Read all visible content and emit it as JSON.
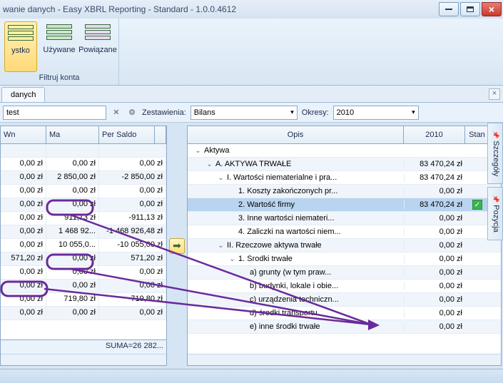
{
  "window": {
    "title": "wanie danych - Easy XBRL Reporting - Standard - 1.0.0.4612"
  },
  "ribbon": {
    "buttons": [
      {
        "label": "ystko"
      },
      {
        "label": "Używane"
      },
      {
        "label": "Powiązane"
      }
    ],
    "group_label": "Filtruj konta"
  },
  "sub_tab": {
    "label": "danych"
  },
  "toolbar": {
    "search_value": "test",
    "zestawienia_label": "Zestawienia:",
    "zestawienia_value": "Bilans",
    "okresy_label": "Okresy:",
    "okresy_value": "2010"
  },
  "left_grid": {
    "headers": {
      "wn": "Wn",
      "ma": "Ma",
      "ps": "Per Saldo"
    },
    "rows": [
      {
        "wn": "",
        "ma": "",
        "ps": ""
      },
      {
        "wn": "0,00 zł",
        "ma": "0,00 zł",
        "ps": "0,00 zł"
      },
      {
        "wn": "0,00 zł",
        "ma": "2 850,00 zł",
        "ps": "-2 850,00 zł"
      },
      {
        "wn": "0,00 zł",
        "ma": "0,00 zł",
        "ps": "0,00 zł"
      },
      {
        "wn": "0,00 zł",
        "ma": "0,00 zł",
        "ps": "0,00 zł"
      },
      {
        "wn": "0,00 zł",
        "ma": "911,13 zł",
        "ps": "-911,13 zł"
      },
      {
        "wn": "0,00 zł",
        "ma": "1 468 92...",
        "ps": "-1 468 926,48 zł"
      },
      {
        "wn": "0,00 zł",
        "ma": "10 055,0...",
        "ps": "-10 055,00 zł"
      },
      {
        "wn": "571,20 zł",
        "ma": "0,00 zł",
        "ps": "571,20 zł"
      },
      {
        "wn": "0,00 zł",
        "ma": "0,00 zł",
        "ps": "0,00 zł"
      },
      {
        "wn": "0,00 zł",
        "ma": "0,00 zł",
        "ps": "0,00 zł"
      },
      {
        "wn": "0,00 zł",
        "ma": "719,80 zł",
        "ps": "-719,80 zł"
      },
      {
        "wn": "0,00 zł",
        "ma": "0,00 zł",
        "ps": "0,00 zł"
      }
    ],
    "footer": "SUMA=26 282..."
  },
  "right_tree": {
    "headers": {
      "opis": "Opis",
      "col2010": "2010",
      "stan": "Stan"
    },
    "rows": [
      {
        "indent": 0,
        "exp": "v",
        "label": "Aktywa",
        "val": "",
        "stan": ""
      },
      {
        "indent": 1,
        "exp": "v",
        "label": "A. AKTYWA TRWAŁE",
        "val": "83 470,24 zł",
        "stan": ""
      },
      {
        "indent": 2,
        "exp": "v",
        "label": "I. Wartości niematerialne i pra...",
        "val": "83 470,24 zł",
        "stan": ""
      },
      {
        "indent": 3,
        "exp": "",
        "label": "1. Koszty zakończonych pr...",
        "val": "0,00 zł",
        "stan": ""
      },
      {
        "indent": 3,
        "exp": "",
        "label": "2. Wartość firmy",
        "val": "83 470,24 zł",
        "stan": "check",
        "sel": true
      },
      {
        "indent": 3,
        "exp": "",
        "label": "3. Inne wartości niemateri...",
        "val": "0,00 zł",
        "stan": ""
      },
      {
        "indent": 3,
        "exp": "",
        "label": "4. Zaliczki na wartości niem...",
        "val": "0,00 zł",
        "stan": ""
      },
      {
        "indent": 2,
        "exp": "v",
        "label": "II. Rzeczowe aktywa trwałe",
        "val": "0,00 zł",
        "stan": ""
      },
      {
        "indent": 3,
        "exp": "v",
        "label": "1. Środki trwałe",
        "val": "0,00 zł",
        "stan": ""
      },
      {
        "indent": 4,
        "exp": "",
        "label": "a) grunty (w tym praw...",
        "val": "0,00 zł",
        "stan": ""
      },
      {
        "indent": 4,
        "exp": "",
        "label": "b) budynki, lokale i obie...",
        "val": "0,00 zł",
        "stan": ""
      },
      {
        "indent": 4,
        "exp": "",
        "label": "c) urządzenia techniczn...",
        "val": "0,00 zł",
        "stan": ""
      },
      {
        "indent": 4,
        "exp": "",
        "label": "d) środki transportu",
        "val": "0,00 zł",
        "stan": ""
      },
      {
        "indent": 4,
        "exp": "",
        "label": "e) inne środki trwałe",
        "val": "0,00 zł",
        "stan": ""
      }
    ]
  },
  "side_panels": {
    "szczegoly": "Szczegóły",
    "pozycja": "Pozycja"
  }
}
